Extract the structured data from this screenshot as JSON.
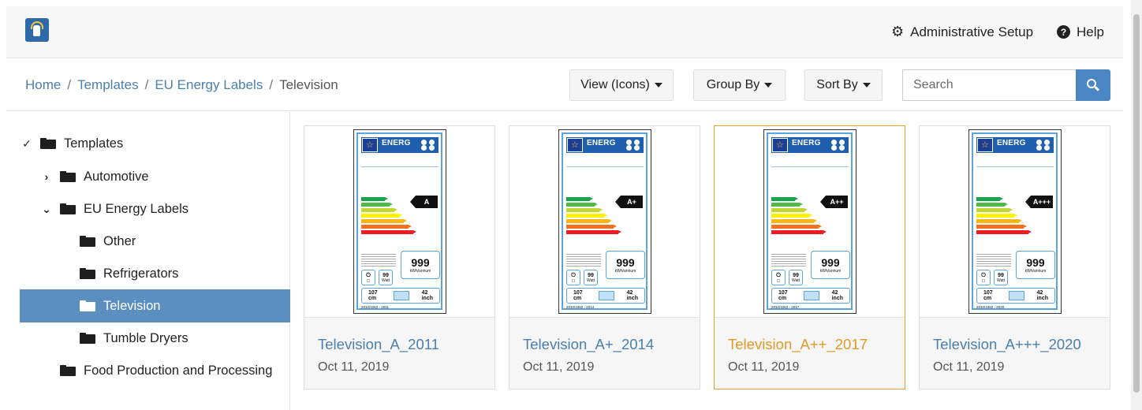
{
  "header": {
    "admin_label": "Administrative Setup",
    "help_label": "Help"
  },
  "breadcrumb": {
    "items": [
      "Home",
      "Templates",
      "EU Energy Labels"
    ],
    "current": "Television",
    "separator": "/"
  },
  "toolbar": {
    "view_label": "View (Icons)",
    "group_label": "Group By",
    "sort_label": "Sort By",
    "search_placeholder": "Search"
  },
  "tree": {
    "items": [
      {
        "label": "Templates",
        "chevron": "down"
      },
      {
        "label": "Automotive",
        "chevron": "right"
      },
      {
        "label": "EU Energy Labels",
        "chevron": "down"
      },
      {
        "label": "Other"
      },
      {
        "label": "Refrigerators"
      },
      {
        "label": "Television",
        "selected": true
      },
      {
        "label": "Tumble Dryers"
      },
      {
        "label": "Food Production and Processing"
      }
    ]
  },
  "cards": [
    {
      "title": "Television_A_2011",
      "date": "Oct 11, 2019",
      "rating": "A",
      "reg": "2010/1062 - 2011",
      "classes": [
        "A",
        "B",
        "C",
        "D",
        "E",
        "F",
        "G"
      ]
    },
    {
      "title": "Television_A+_2014",
      "date": "Oct 11, 2019",
      "rating": "A+",
      "reg": "2010/1062 - 2014",
      "classes": [
        "A+",
        "A",
        "B",
        "C",
        "D",
        "E",
        "F"
      ]
    },
    {
      "title": "Television_A++_2017",
      "date": "Oct 11, 2019",
      "rating": "A++",
      "reg": "2010/1062 - 2017",
      "classes": [
        "A++",
        "A+",
        "A",
        "B",
        "C",
        "D",
        "E"
      ]
    },
    {
      "title": "Television_A+++_2020",
      "date": "Oct 11, 2019",
      "rating": "A+++",
      "reg": "2010/1062 - 2020",
      "classes": [
        "A+++",
        "A++",
        "A+",
        "A",
        "B",
        "C",
        "D"
      ]
    }
  ],
  "label_common": {
    "energ": "ENERG",
    "kwh_value": "999",
    "kwh_unit": "kWh/annum",
    "watt_value": "99",
    "watt_unit": "Watt",
    "cm_value": "107",
    "cm_unit": "cm",
    "inch_value": "42",
    "inch_unit": "inch"
  },
  "colors": {
    "accent": "#4a86c4",
    "link": "#4a7fae",
    "selected": "#5b8fbf",
    "highlight": "#e29a26",
    "energy_scale": [
      "#16a34a",
      "#52b848",
      "#bfd730",
      "#fff200",
      "#fbb615",
      "#f37021",
      "#ed1c24"
    ]
  }
}
